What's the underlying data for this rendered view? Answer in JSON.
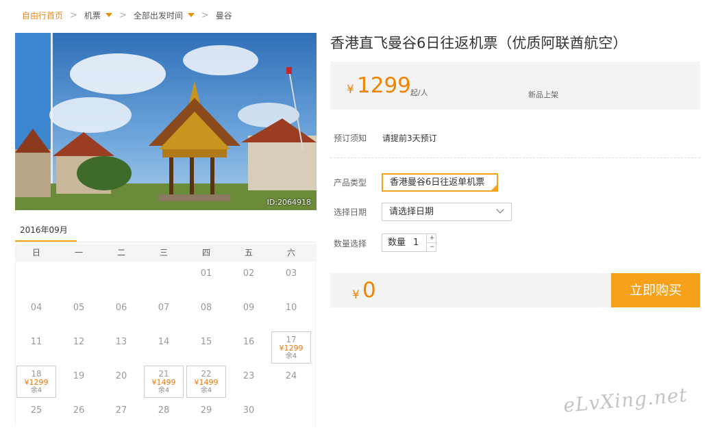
{
  "breadcrumb": {
    "home": "自由行首页",
    "category": "机票",
    "departure": "全部出发时间",
    "destination": "曼谷"
  },
  "photo": {
    "id_label": "ID:2064918"
  },
  "calendar": {
    "month": "2016年09月",
    "weekdays": [
      "日",
      "一",
      "二",
      "三",
      "四",
      "五",
      "六"
    ],
    "weeks": [
      [
        null,
        null,
        null,
        null,
        {
          "d": "01"
        },
        {
          "d": "02"
        },
        {
          "d": "03"
        }
      ],
      [
        {
          "d": "04"
        },
        {
          "d": "05"
        },
        {
          "d": "06"
        },
        {
          "d": "07"
        },
        {
          "d": "08"
        },
        {
          "d": "09"
        },
        {
          "d": "10"
        }
      ],
      [
        {
          "d": "11"
        },
        {
          "d": "12"
        },
        {
          "d": "13"
        },
        {
          "d": "14"
        },
        {
          "d": "15"
        },
        {
          "d": "16"
        },
        {
          "d": "17",
          "price": "¥1299",
          "stock": "余4"
        }
      ],
      [
        {
          "d": "18",
          "price": "¥1299",
          "stock": "余4"
        },
        {
          "d": "19"
        },
        {
          "d": "20"
        },
        {
          "d": "21",
          "price": "¥1499",
          "stock": "余4"
        },
        {
          "d": "22",
          "price": "¥1499",
          "stock": "余4"
        },
        {
          "d": "23"
        },
        {
          "d": "24"
        }
      ],
      [
        {
          "d": "25"
        },
        {
          "d": "26"
        },
        {
          "d": "27"
        },
        {
          "d": "28"
        },
        {
          "d": "29"
        },
        {
          "d": "30"
        },
        null
      ]
    ]
  },
  "product": {
    "title": "香港直飞曼谷6日往返机票（优质阿联酋航空）",
    "price_symbol": "¥",
    "price": "1299",
    "price_unit": "起/人",
    "new_tag": "新品上架",
    "notice_label": "预订须知",
    "notice_value": "请提前3天预订",
    "type_label": "产品类型",
    "type_value": "香港曼谷6日往返单机票",
    "date_label": "选择日期",
    "date_placeholder": "请选择日期",
    "qty_label": "数量选择",
    "qty_inner_label": "数量",
    "qty_value": "1",
    "qty_plus": "+",
    "qty_minus": "−"
  },
  "order": {
    "total_symbol": "¥",
    "total": "0",
    "buy_label": "立即购买"
  },
  "watermark": "eLvXing.net",
  "colors": {
    "accent": "#f08300",
    "button": "#f7a11a",
    "link": "#e8891a"
  }
}
